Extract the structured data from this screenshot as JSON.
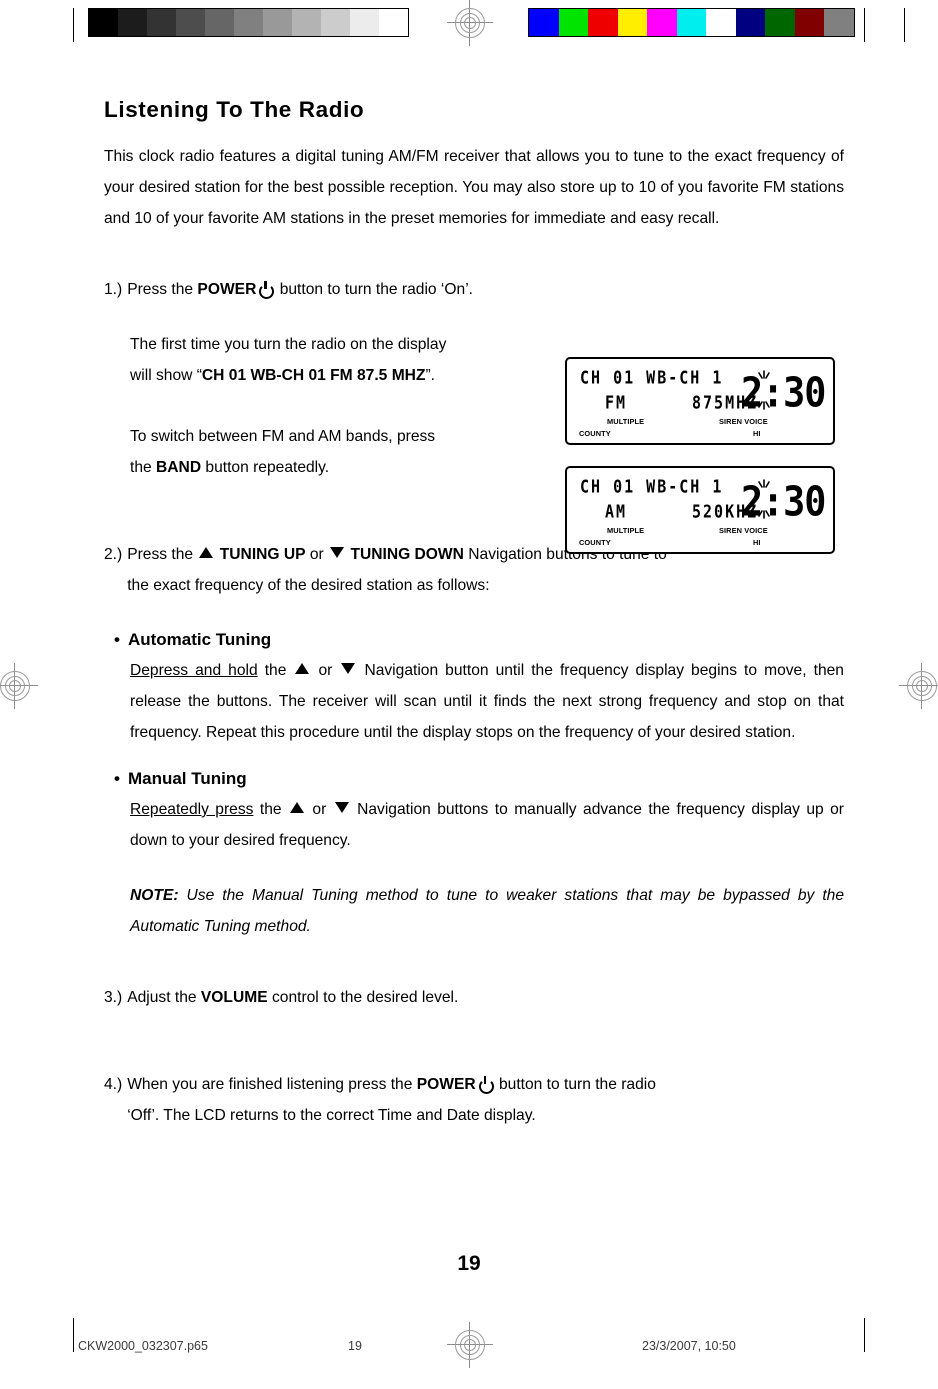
{
  "document": {
    "page_title": "Listening To The Radio",
    "folio": "19"
  },
  "intro": {
    "paragraph": "This clock radio features a digital tuning AM/FM receiver that allows you to tune to the exact frequency of your desired station for the best possible reception. You may also store up to 10 of you favorite FM stations and 10 of your favorite AM stations in the preset memories for immediate and easy recall."
  },
  "steps": {
    "step1": {
      "number": "1.)",
      "text_before": "Press the",
      "bold_label": "POWER",
      "icon": "power-icon",
      "text_after": "button to turn the radio ‘On’."
    },
    "step1_note_a": {
      "line1": "The first time you turn the radio on the display",
      "line2_before": "will show “",
      "line2_bold": "CH 01  WB-CH 01 FM 87.5 MHZ",
      "line2_after": "”."
    },
    "step1_note_b": {
      "line1": "To switch between FM and AM bands, press",
      "line2_before": "the",
      "line2_bold": "BAND",
      "line2_after": "button repeatedly."
    },
    "step2": {
      "number": "2.)",
      "text_before": "Press the",
      "bold_up": "TUNING UP",
      "joiner": "or",
      "bold_down": "TUNING DOWN",
      "text_after": "Navigation buttons to tune to",
      "line2": "the exact frequency of the desired station as follows:"
    },
    "step3": {
      "number": "3.)",
      "text_before": "Adjust the",
      "bold_label": "VOLUME",
      "text_after": "control to the desired level."
    },
    "step4": {
      "number": "4.)",
      "text_before": "When you are finished listening press the",
      "bold_label": "POWER",
      "icon": "power-icon",
      "text_after": "button to turn the radio",
      "line2": "‘Off’. The LCD returns to the correct Time and Date display."
    }
  },
  "bullets": [
    {
      "marker": "•",
      "heading": "Automatic Tuning",
      "underlined_lead": "Depress and hold",
      "text_mid_a": "the",
      "text_mid_b": "or",
      "text_after": "Navigation button until the frequency display begins to move, then release the buttons. The receiver will scan until it finds the next strong frequency and stop on that frequency. Repeat this procedure until the display stops on the frequency of your desired station."
    },
    {
      "marker": "•",
      "heading": "Manual Tuning",
      "underlined_lead": "Repeatedly press",
      "text_mid_a": "the",
      "text_mid_b": "or",
      "text_after": "Navigation buttons to manually advance the frequency display up or down to your desired frequency."
    }
  ],
  "note": {
    "label": "NOTE:",
    "text": "Use the Manual Tuning method to tune to weaker stations that may be bypassed by the Automatic Tuning method."
  },
  "lcd_displays": [
    {
      "name": "fm-display",
      "line1": "CH 01 WB-CH 1",
      "band": "FM",
      "frequency": "875MHZ",
      "time": "2:30",
      "label_multiple": "MULTIPLE",
      "label_county": "COUNTY",
      "label_siren_voice": "SIREN VOICE",
      "label_hi": "HI"
    },
    {
      "name": "am-display",
      "line1": "CH 01 WB-CH 1",
      "band": "AM",
      "frequency": "520KHZ",
      "time": "2:30",
      "label_multiple": "MULTIPLE",
      "label_county": "COUNTY",
      "label_siren_voice": "SIREN VOICE",
      "label_hi": "HI"
    }
  ],
  "footer": {
    "file_name": "CKW2000_032307.p65",
    "page_number": "19",
    "timestamp": "23/3/2007, 10:50"
  },
  "calibration": {
    "gray_wedge": [
      "#000000",
      "#1c1c1c",
      "#333333",
      "#4d4d4d",
      "#666666",
      "#808080",
      "#999999",
      "#b3b3b3",
      "#cccccc",
      "#ececec",
      "#ffffff"
    ],
    "color_bars": [
      "#0000ff",
      "#00e400",
      "#ee0000",
      "#ffee00",
      "#ff00ff",
      "#00eeee",
      "#ffffff",
      "#000080",
      "#006600",
      "#800000",
      "#808080"
    ]
  }
}
